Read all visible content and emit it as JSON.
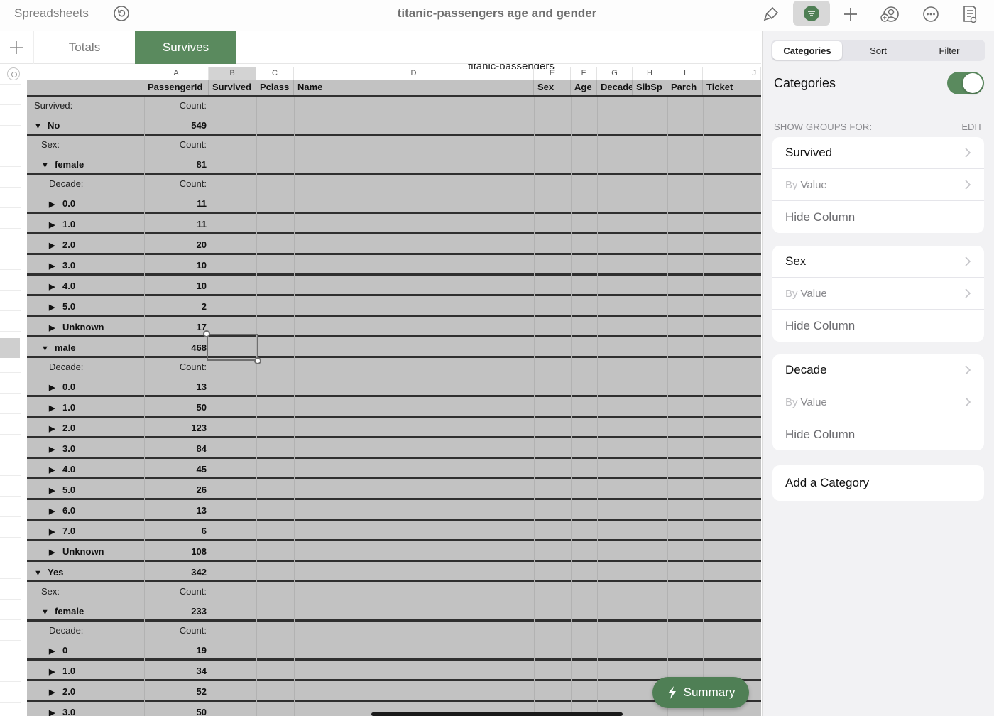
{
  "topbar": {
    "back_label": "Spreadsheets",
    "title": "titanic-passengers age and gender",
    "icons": [
      "undo-icon",
      "format-brush-icon",
      "categories-icon",
      "add-icon",
      "collaborate-icon",
      "more-icon",
      "document-options-icon"
    ]
  },
  "tabs": {
    "items": [
      {
        "label": "Totals",
        "active": false
      },
      {
        "label": "Survives",
        "active": true
      }
    ]
  },
  "sheet": {
    "table_title": "titanic-passengers",
    "column_letters": [
      "A",
      "B",
      "C",
      "D",
      "E",
      "F",
      "G",
      "H",
      "I",
      "J"
    ],
    "headers": [
      "PassengerId",
      "Survived",
      "Pclass",
      "Name",
      "Sex",
      "Age",
      "Decade",
      "SibSp",
      "Parch",
      "Ticket"
    ],
    "rows": [
      {
        "label": "Survived:",
        "value": "Count:",
        "kind": "caption",
        "level": 0
      },
      {
        "label": "No",
        "value": "549",
        "kind": "group-open",
        "level": 0
      },
      {
        "label": "Sex:",
        "value": "Count:",
        "kind": "caption",
        "level": 1
      },
      {
        "label": "female",
        "value": "81",
        "kind": "group-open",
        "level": 1
      },
      {
        "label": "Decade:",
        "value": "Count:",
        "kind": "caption",
        "level": 2
      },
      {
        "label": "0.0",
        "value": "11",
        "kind": "group-closed",
        "level": 2
      },
      {
        "label": "1.0",
        "value": "11",
        "kind": "group-closed",
        "level": 2
      },
      {
        "label": "2.0",
        "value": "20",
        "kind": "group-closed",
        "level": 2
      },
      {
        "label": "3.0",
        "value": "10",
        "kind": "group-closed",
        "level": 2
      },
      {
        "label": "4.0",
        "value": "10",
        "kind": "group-closed",
        "level": 2
      },
      {
        "label": "5.0",
        "value": "2",
        "kind": "group-closed",
        "level": 2
      },
      {
        "label": "Unknown",
        "value": "17",
        "kind": "group-closed",
        "level": 2
      },
      {
        "label": "male",
        "value": "468",
        "kind": "group-open",
        "level": 1
      },
      {
        "label": "Decade:",
        "value": "Count:",
        "kind": "caption",
        "level": 2
      },
      {
        "label": "0.0",
        "value": "13",
        "kind": "group-closed",
        "level": 2
      },
      {
        "label": "1.0",
        "value": "50",
        "kind": "group-closed",
        "level": 2
      },
      {
        "label": "2.0",
        "value": "123",
        "kind": "group-closed",
        "level": 2
      },
      {
        "label": "3.0",
        "value": "84",
        "kind": "group-closed",
        "level": 2
      },
      {
        "label": "4.0",
        "value": "45",
        "kind": "group-closed",
        "level": 2
      },
      {
        "label": "5.0",
        "value": "26",
        "kind": "group-closed",
        "level": 2
      },
      {
        "label": "6.0",
        "value": "13",
        "kind": "group-closed",
        "level": 2
      },
      {
        "label": "7.0",
        "value": "6",
        "kind": "group-closed",
        "level": 2
      },
      {
        "label": "Unknown",
        "value": "108",
        "kind": "group-closed",
        "level": 2
      },
      {
        "label": "Yes",
        "value": "342",
        "kind": "group-open",
        "level": 0
      },
      {
        "label": "Sex:",
        "value": "Count:",
        "kind": "caption",
        "level": 1
      },
      {
        "label": "female",
        "value": "233",
        "kind": "group-open",
        "level": 1
      },
      {
        "label": "Decade:",
        "value": "Count:",
        "kind": "caption",
        "level": 2
      },
      {
        "label": "0",
        "value": "19",
        "kind": "group-closed",
        "level": 2
      },
      {
        "label": "1.0",
        "value": "34",
        "kind": "group-closed",
        "level": 2
      },
      {
        "label": "2.0",
        "value": "52",
        "kind": "group-closed",
        "level": 2
      },
      {
        "label": "3.0",
        "value": "50",
        "kind": "group-closed",
        "level": 2
      }
    ],
    "summary_label": "Summary"
  },
  "panel": {
    "segments": [
      {
        "label": "Categories",
        "active": true
      },
      {
        "label": "Sort",
        "active": false
      },
      {
        "label": "Filter",
        "active": false
      }
    ],
    "categories_label": "Categories",
    "categories_enabled": true,
    "section_header": "SHOW GROUPS FOR:",
    "edit_label": "EDIT",
    "groups": [
      {
        "name": "Survived",
        "by_prefix": "By",
        "by_value": "Value",
        "hide_label": "Hide Column"
      },
      {
        "name": "Sex",
        "by_prefix": "By",
        "by_value": "Value",
        "hide_label": "Hide Column"
      },
      {
        "name": "Decade",
        "by_prefix": "By",
        "by_value": "Value",
        "hide_label": "Hide Column"
      }
    ],
    "add_category_label": "Add a Category"
  },
  "colors": {
    "accent_green": "#5a8a5e",
    "summary_green": "#4f7f55",
    "group_gray": "#c2c2c2"
  }
}
